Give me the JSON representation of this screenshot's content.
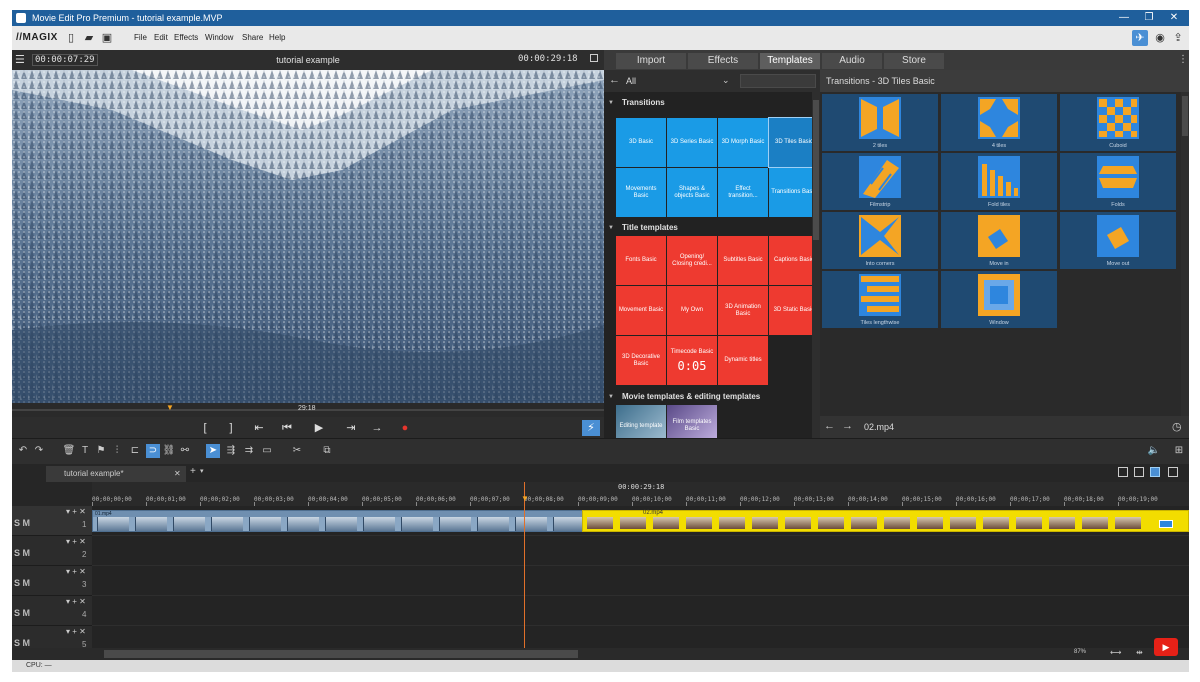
{
  "window": {
    "title": "Movie Edit Pro Premium - tutorial example.MVP",
    "minimize": "—",
    "restore": "❐",
    "close": "✕"
  },
  "menubar": {
    "logo": "//MAGIX",
    "items": [
      "File",
      "Edit",
      "Effects",
      "Window",
      "Share",
      "Help"
    ]
  },
  "preview": {
    "timecode_left": "00:00:07:29",
    "title": "tutorial example",
    "timecode_right": "00:00:29:18",
    "scrub_marker": "29:18"
  },
  "tabs": [
    "Import",
    "Effects",
    "Templates",
    "Audio",
    "Store"
  ],
  "active_tab": "Templates",
  "category": {
    "dropdown_value": "All",
    "sections": [
      {
        "title": "Transitions",
        "tiles": [
          "3D Basic",
          "3D Series Basic",
          "3D Morph Basic",
          "3D Tiles Basic",
          "Movements Basic",
          "Shapes & objects Basic",
          "Effect transition...",
          "Transitions Basic"
        ]
      },
      {
        "title": "Title templates",
        "tiles": [
          "Fonts Basic",
          "Opening/ Closing credi...",
          "Subtitles Basic",
          "Captions Basic",
          "Movement Basic",
          "My Own",
          "3D Animation Basic",
          "3D Static Basic",
          "3D Decorative Basic",
          "Timecode Basic",
          "Dynamic titles"
        ]
      },
      {
        "title": "Movie templates & editing templates",
        "tiles": [
          "Editing template",
          "Film templates Basic"
        ]
      }
    ],
    "timecode_overlay": "0:05"
  },
  "transitions_panel": {
    "title": "Transitions - 3D Tiles Basic",
    "items": [
      "2 tiles",
      "4 tiles",
      "Cuboid",
      "Filmstrip",
      "Fold tiles",
      "Folds",
      "Into corners",
      "Move in",
      "Move out",
      "Tiles lengthwise",
      "Window"
    ],
    "footer_file": "02.mp4"
  },
  "timeline": {
    "project_tab": "tutorial example*",
    "position": "00:00:29:18",
    "ruler": [
      "00;00;00;00",
      "00;00;01;00",
      "00;00;02;00",
      "00;00;03;00",
      "00;00;04;00",
      "00;00;05;00",
      "00;00;06;00",
      "00;00;07;00",
      "00;00;08;00",
      "00;00;09;00",
      "00;00;10;00",
      "00;00;11;00",
      "00;00;12;00",
      "00;00;13;00",
      "00;00;14;00",
      "00;00;15;00",
      "00;00;16;00",
      "00;00;17;00",
      "00;00;18;00",
      "00;00;19;00"
    ],
    "tracks": [
      "1",
      "2",
      "3",
      "4",
      "5"
    ],
    "track_sm_label": "S M",
    "clip1_name": "01.mp4",
    "clip2_name": "02.mp4",
    "zoom": "87%"
  },
  "status": {
    "cpu": "CPU: —"
  },
  "colors": {
    "titlebar": "#1f5f9c",
    "transition_tile": "#1a9be6",
    "title_tile": "#ee3a30",
    "clip_selected": "#f2dd00",
    "tile_orange": "#f4a524",
    "tile_blue": "#2e86de"
  }
}
